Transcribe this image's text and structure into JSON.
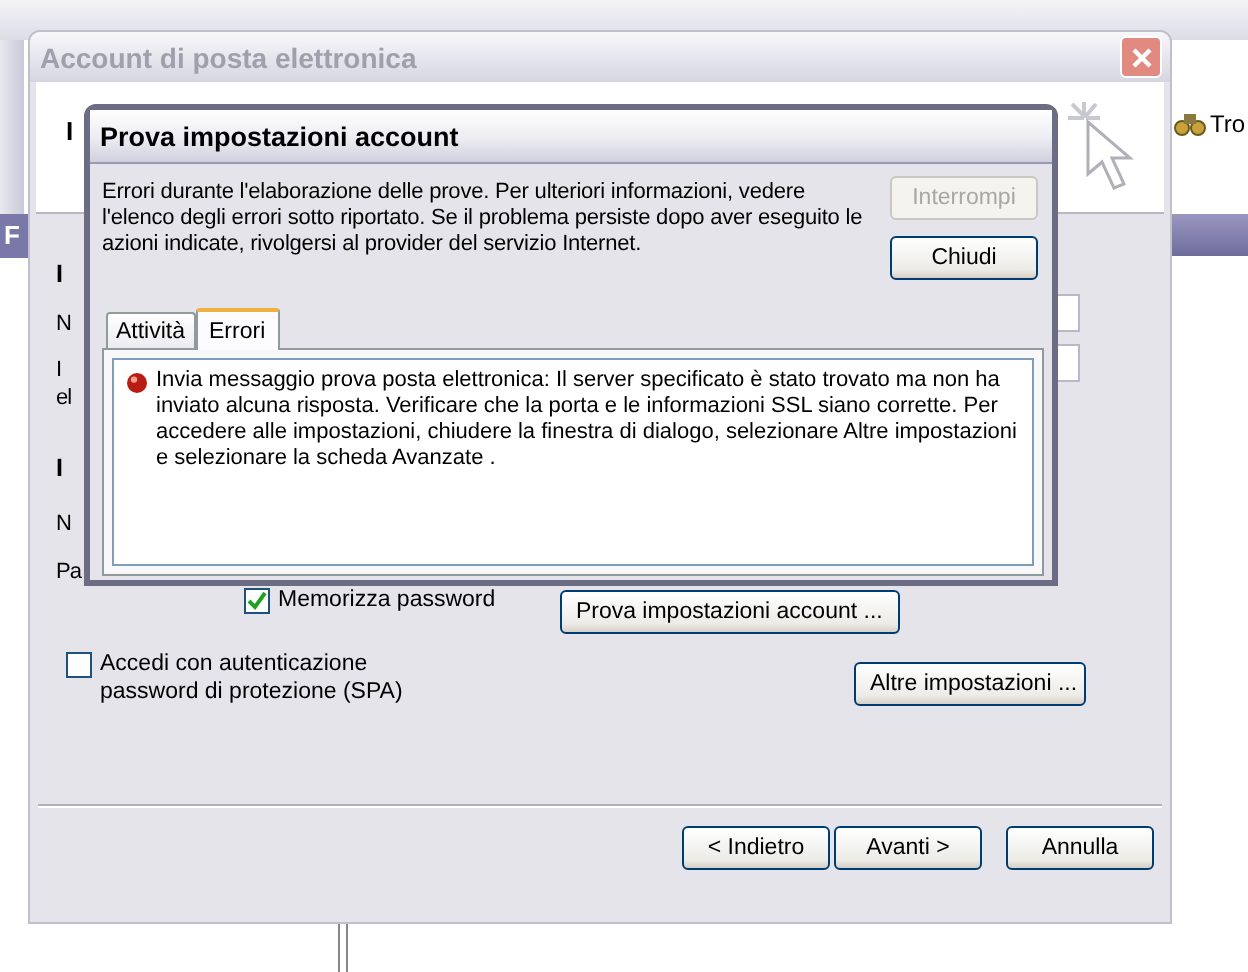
{
  "app_window": {
    "toolbar_button": "Tro",
    "pane_letter": "F"
  },
  "dialog": {
    "title": "Account di posta elettronica",
    "header_fragment": "I",
    "fragments": [
      {
        "text": "I",
        "bold": true
      },
      {
        "text": "N",
        "bold": false
      },
      {
        "text": "I",
        "bold": false
      },
      {
        "text": "el",
        "bold": false
      },
      {
        "text": "I",
        "bold": true
      },
      {
        "text": "N",
        "bold": false
      },
      {
        "text": "Pa",
        "bold": false
      }
    ],
    "checkboxes": [
      {
        "label": "Memorizza password",
        "checked": true
      },
      {
        "label": "Accedi con autenticazione password di protezione (SPA)",
        "checked": false
      }
    ],
    "test_button": "Prova impostazioni account ...",
    "more_button": "Altre impostazioni ...",
    "nav_buttons": [
      {
        "label": "< Indietro"
      },
      {
        "label": "Avanti >"
      },
      {
        "label": "Annulla"
      }
    ]
  },
  "test_dialog": {
    "title": "Prova impostazioni account",
    "message": "Errori durante l'elaborazione delle prove. Per ulteriori informazioni, vedere l'elenco degli errori sotto riportato. Se il problema persiste dopo aver eseguito le azioni indicate, rivolgersi al provider del servizio Internet.",
    "buttons": [
      {
        "label": "Interrompi",
        "disabled": true
      },
      {
        "label": "Chiudi",
        "disabled": false
      }
    ],
    "tabs": [
      {
        "label": "Attività",
        "selected": false
      },
      {
        "label": "Errori",
        "selected": true
      }
    ],
    "errors": [
      {
        "text": "Invia messaggio prova posta elettronica: Il server specificato è stato trovato ma non ha inviato alcuna risposta. Verificare che la porta e le informazioni SSL siano corrette. Per accedere alle impostazioni, chiudere la finestra di dialogo, selezionare Altre impostazioni e selezionare la scheda Avanzate ."
      }
    ]
  }
}
